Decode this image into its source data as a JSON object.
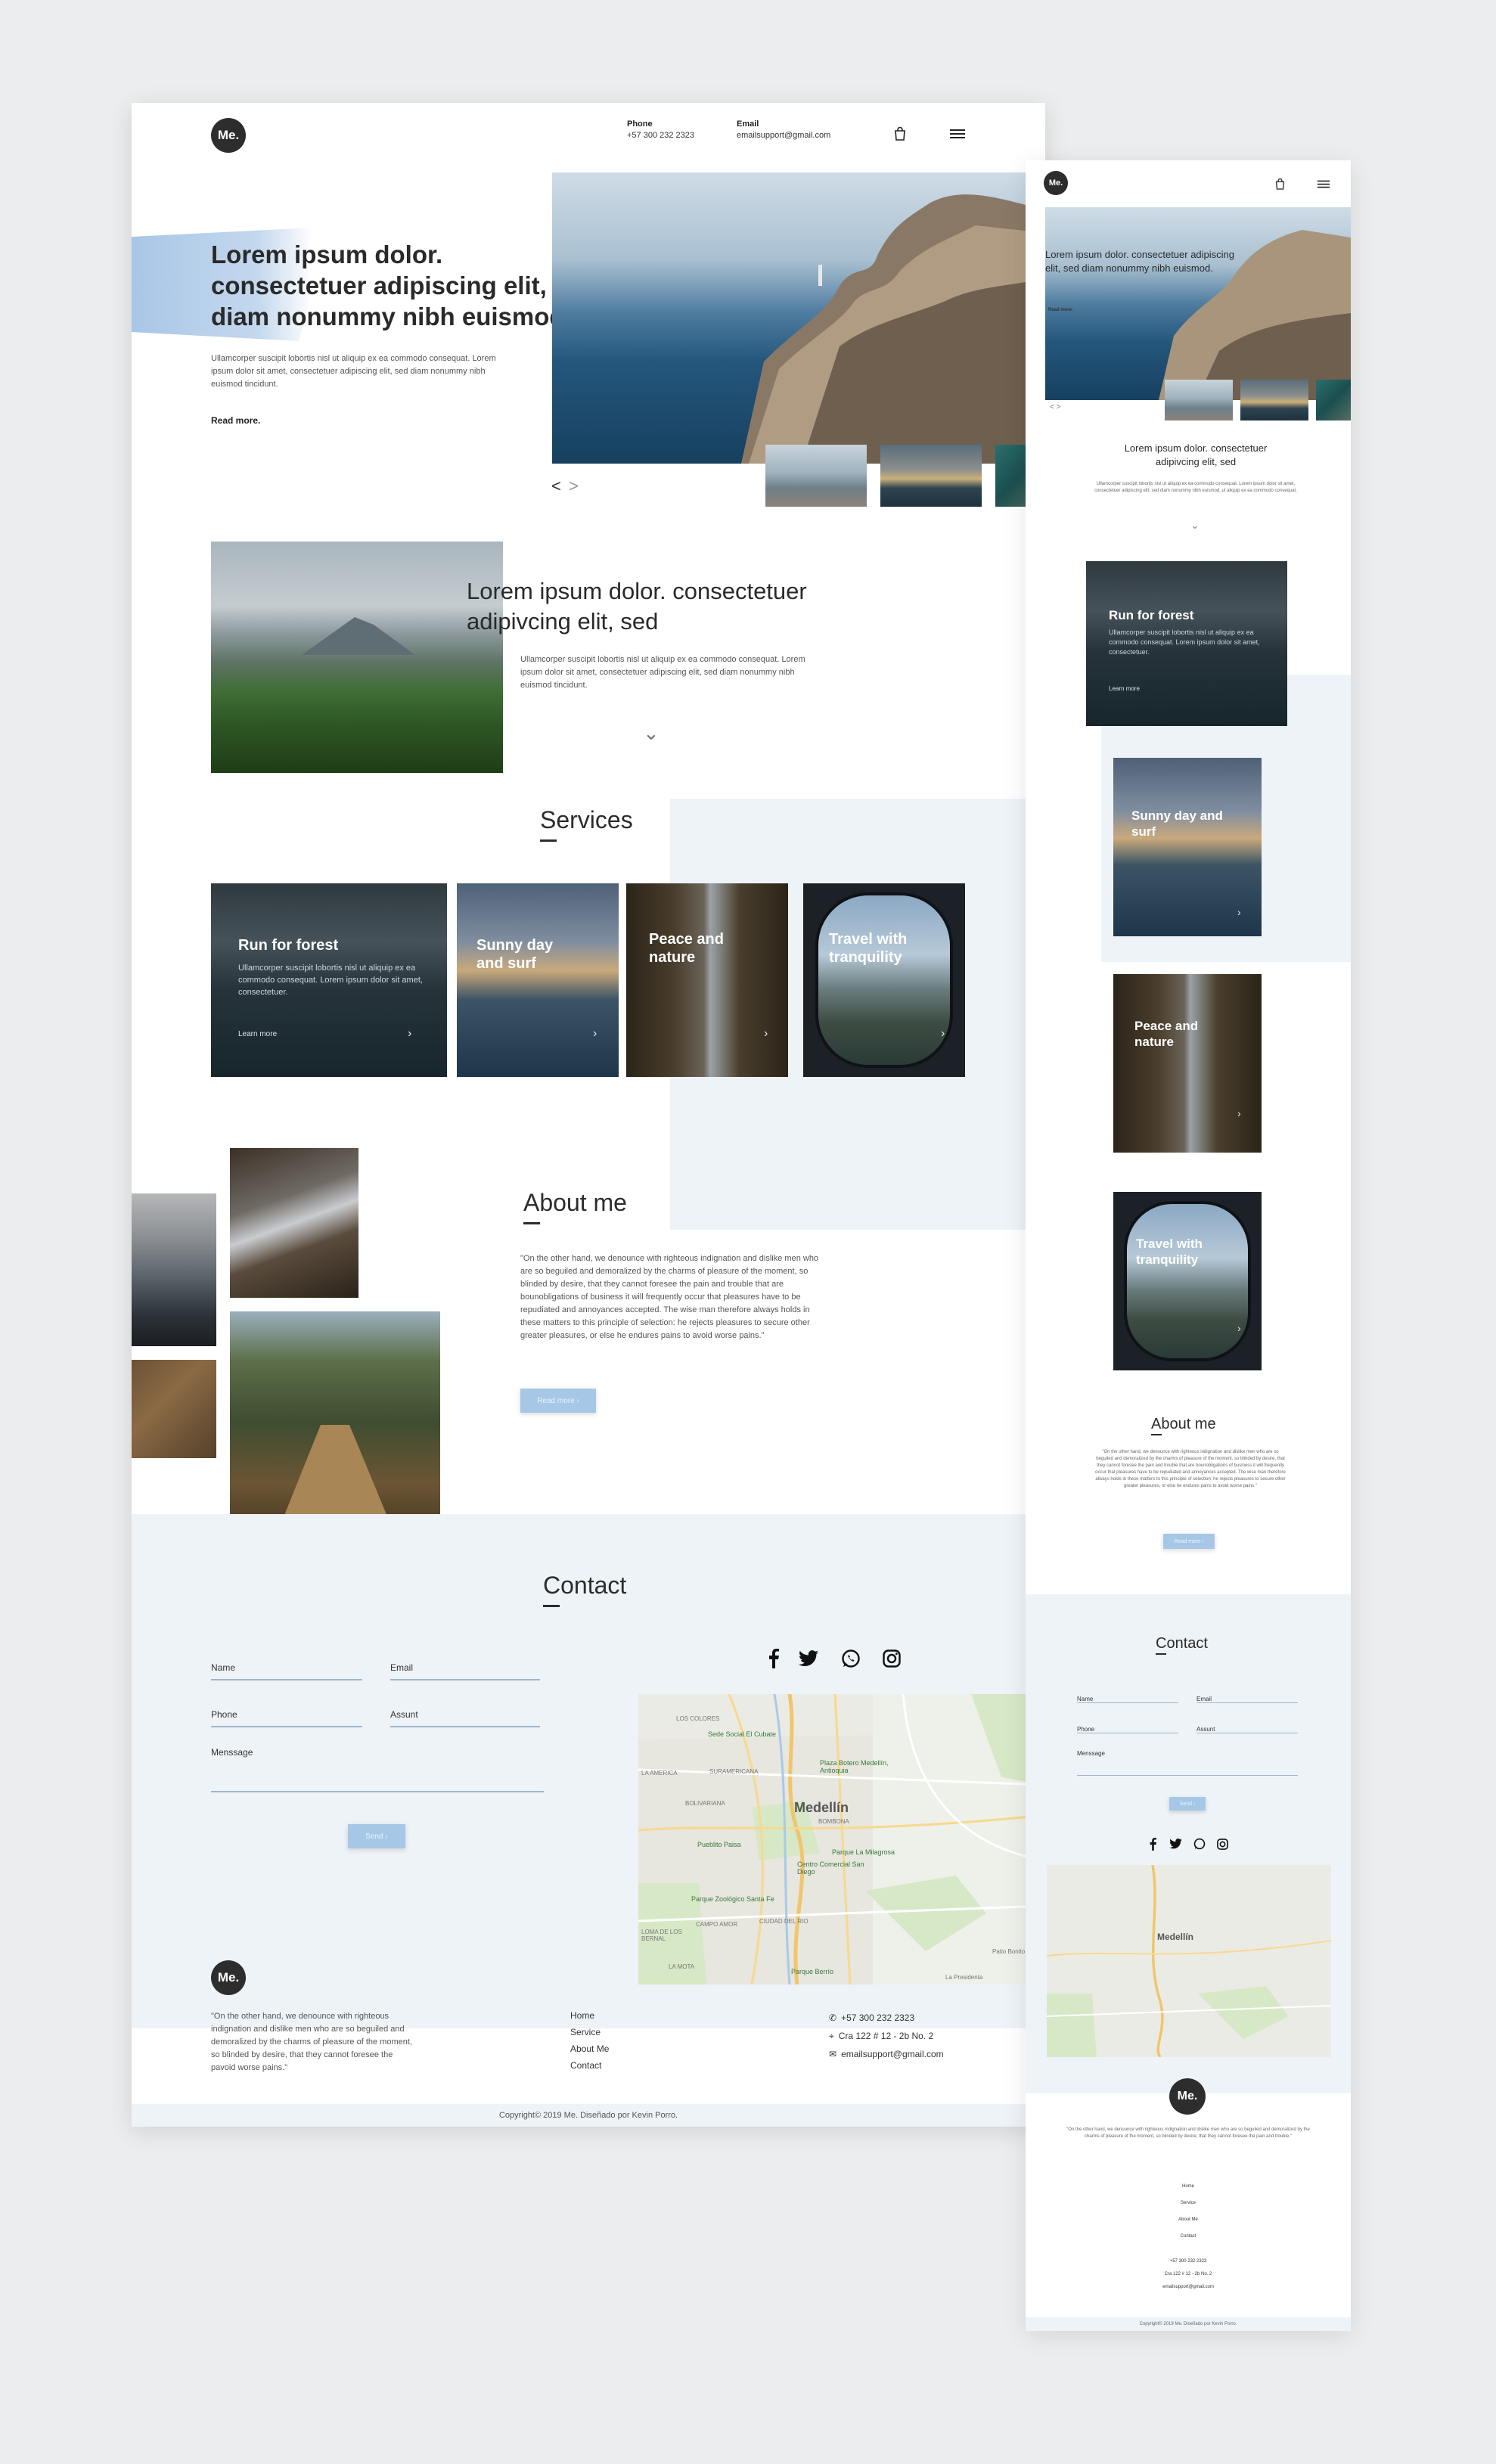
{
  "brand": {
    "logo": "Me."
  },
  "header": {
    "phone_label": "Phone",
    "phone_value": "+57 300 232 2323",
    "email_label": "Email",
    "email_value": "emailsupport@gmail.com",
    "cart_icon": "shopping-bag-icon",
    "menu_icon": "hamburger-menu-icon"
  },
  "hero": {
    "title": "Lorem ipsum dolor. consectetuer adipiscing elit, sed diam nonummy nibh euismod.",
    "body": "Ullamcorper suscipit lobortis nisl ut aliquip ex ea commodo consequat. Lorem ipsum dolor sit amet, consectetuer adipiscing elit, sed diam nonummy nibh euismod tincidunt.",
    "read_more": "Read more.",
    "prev": "<",
    "next": ">"
  },
  "intro": {
    "title": "Lorem ipsum dolor. consectetuer adipivcing elit, sed",
    "body": "Ullamcorper suscipit lobortis nisl ut aliquip ex ea commodo consequat. Lorem ipsum dolor sit amet, consectetuer adipiscing elit, sed diam nonummy nibh euismod tincidunt.",
    "chevron": "⌄"
  },
  "services": {
    "title": "Services",
    "cards": [
      {
        "title": "Run for forest",
        "desc": "Ullamcorper suscipit lobortis nisl ut aliquip ex ea commodo consequat. Lorem ipsum dolor sit amet, consectetuer.",
        "more": "Learn more",
        "chev": "›"
      },
      {
        "title": "Sunny day and surf",
        "chev": "›"
      },
      {
        "title": "Peace and nature",
        "chev": "›"
      },
      {
        "title": "Travel with tranquility",
        "chev": "›"
      }
    ]
  },
  "about": {
    "title": "About me",
    "body": "\"On the other hand, we denounce with righteous indignation and dislike men who are so beguiled and demoralized by the charms of pleasure of the moment, so blinded by desire, that they cannot foresee the pain and trouble that are bounobligations of business it will frequently occur that pleasures have to be repudiated and annoyances accepted. The wise man therefore always holds in these matters to this principle of selection: he rejects pleasures to secure other greater pleasures, or else he endures pains to avoid worse pains.\"",
    "button": "Read more  ›"
  },
  "contact": {
    "title": "Contact",
    "name": "Name",
    "email": "Email",
    "phone": "Phone",
    "assunt": "Assunt",
    "message": "Menssage",
    "send": "Send  ›",
    "social": [
      "facebook-icon",
      "twitter-icon",
      "whatsapp-icon",
      "instagram-icon"
    ]
  },
  "map": {
    "labels": [
      "Sede Social El Cubate",
      "Plaza Botero Medellín, Antioquia",
      "LOS COLORES",
      "SURAMERICANA",
      "LA AMERICA",
      "BOLIVARIANA",
      "Medellín",
      "BOMBONA",
      "Pueblito Paisa",
      "Parque La Milagrosa",
      "Centro Comercial San Diego",
      "Parque Zoológico Santa Fe",
      "CAMPO AMOR",
      "CIUDAD DEL RIO",
      "LOMA DE LOS BERNAL",
      "LA MOTA",
      "Parque Berrío",
      "Patio Bonito",
      "La Presidenta"
    ]
  },
  "footer": {
    "quote": "\"On the other hand, we denounce with righteous indignation and dislike men who are so beguiled and demoralized by the charms of pleasure of the moment, so blinded by desire, that they cannot foresee the pavoid worse pains.\"",
    "links": [
      "Home",
      "Service",
      "About Me",
      "Contact"
    ],
    "phone": "+57 300 232 2323",
    "address": "Cra 122 # 12 - 2b No. 2",
    "email": "emailsupport@gmail.com",
    "copyright": "Copyright© 2019 Me. Diseñado por Kevin Porro."
  },
  "mobile": {
    "hero_title": "Lorem ipsum dolor. consectetuer adipiscing elit, sed diam nonummy nibh euismod.",
    "read_more": "Read more.",
    "nav": "< >",
    "intro_title": "Lorem ipsum dolor. consectetuer adipivcing elit, sed",
    "intro_body": "Ullamcorper suscipit lobortis nisl ut aliquip ex ea commodo consequat. Lorem ipsum dolor sit amet, consectetuer adipiscing elit, sed diam nonummy nibh euismod, ut aliquip ex ea commodo consequat.",
    "chevron": "⌄",
    "about_body": "\"On the other hand, we denounce with righteous indignation and dislike men who are so beguiled and demoralized by the charms of pleasure of the moment, so blinded by desire, that they cannot foresee the pain and trouble that are bounobligations of business it will frequently occur that pleasures have to be repudiated and annoyances accepted. The wise man therefore always holds in these matters to this principle of selection: he rejects pleasures to secure other greater pleasures, or else he endures pains to avoid worse pains.\"",
    "about_button": "Read more  ›",
    "send": "Send  ›",
    "footer_quote": "\"On the other hand, we denounce with righteous indignation and dislike men who are so beguiled and demoralized by the charms of pleasure of the moment, so blinded by desire, that they cannot foresee the pain and trouble.\"",
    "copyright": "Copyright© 2019 Me. Diseñado por Kevin Porro."
  },
  "colors": {
    "page_bg": "#ecedee",
    "panel_blue": "#eef3f8",
    "accent_blue": "#a6c8e6",
    "dark": "#2c2c2c"
  }
}
